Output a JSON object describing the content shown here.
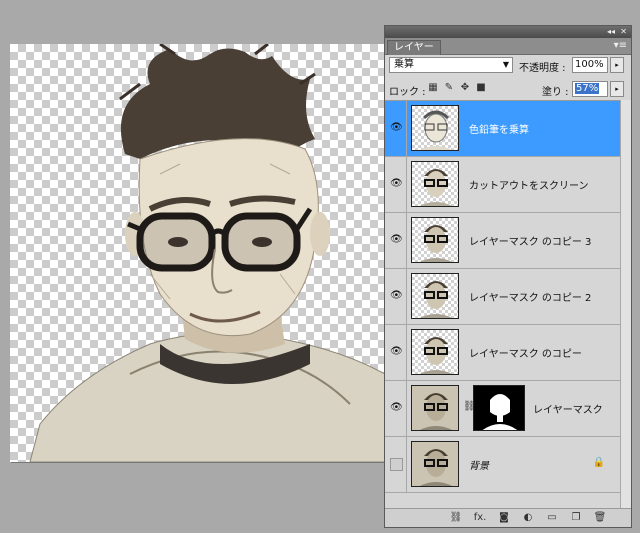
{
  "panel": {
    "tab_label": "レイヤー",
    "collapse_glyph": "◂◂",
    "close_glyph": "✕",
    "menu_glyph": "▾≡"
  },
  "blend": {
    "mode": "乗算",
    "opacity_label": "不透明度 :",
    "opacity_value": "100%"
  },
  "lock": {
    "label": "ロック :",
    "fill_label": "塗り :",
    "fill_value": "57%"
  },
  "layers": [
    {
      "name": "色鉛筆を乗算",
      "visible": true,
      "selected": true
    },
    {
      "name": "カットアウトをスクリーン",
      "visible": true,
      "selected": false
    },
    {
      "name": "レイヤーマスク のコピー 3",
      "visible": true,
      "selected": false
    },
    {
      "name": "レイヤーマスク のコピー 2",
      "visible": true,
      "selected": false
    },
    {
      "name": "レイヤーマスク のコピー",
      "visible": true,
      "selected": false
    },
    {
      "name": "レイヤーマスク",
      "visible": true,
      "selected": false
    },
    {
      "name": "背景",
      "visible": false,
      "selected": false
    }
  ],
  "glyphs": {
    "eye": "👁",
    "link": "⛓",
    "lock": "🔒",
    "stepper": "▸",
    "dropdown": "▼"
  },
  "bottom_icons": [
    "link-layers-icon",
    "fx-icon",
    "mask-icon",
    "adjustment-icon",
    "group-icon",
    "new-layer-icon",
    "trash-icon"
  ],
  "bottom_fx_label": "fx."
}
